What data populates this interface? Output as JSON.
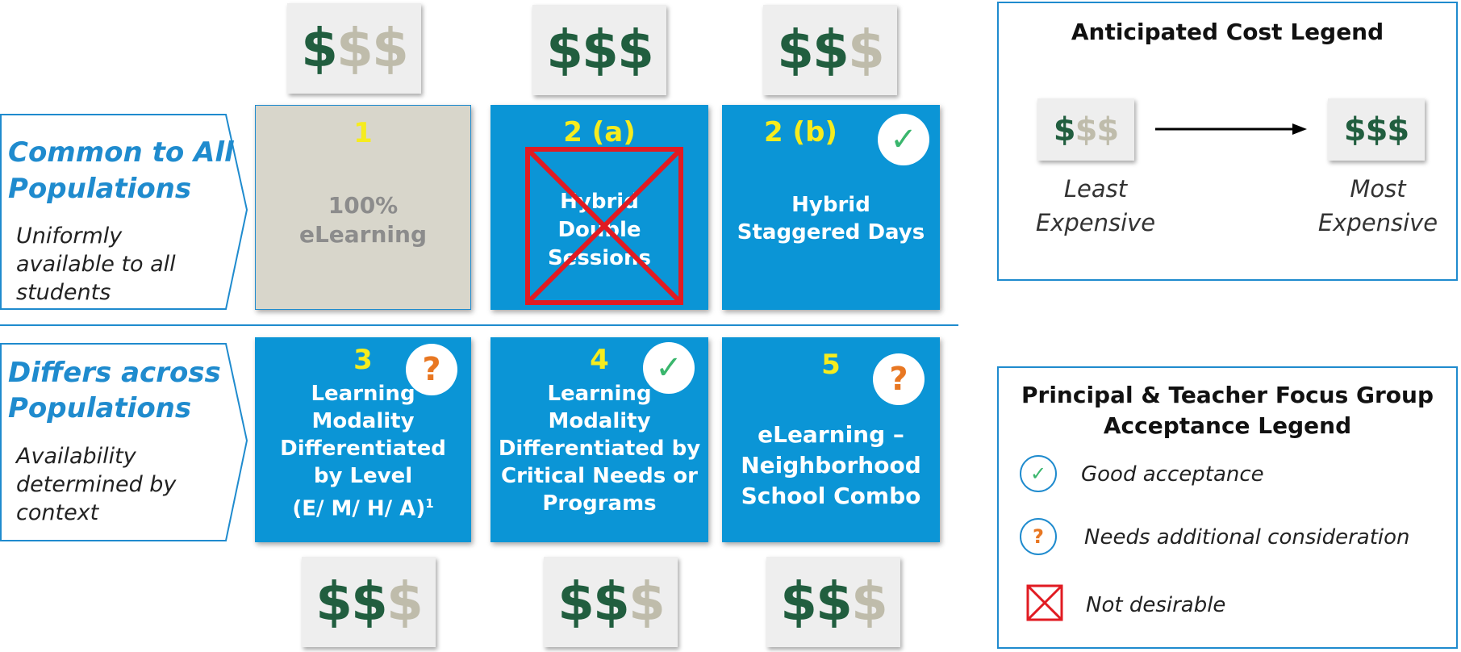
{
  "colors": {
    "blue_tile": "#0b95d6",
    "gray_tile": "#d8d6cb",
    "number_yellow": "#f6ec1e",
    "dollar_active": "#215e3f",
    "dollar_inactive": "#bfbcab",
    "accent_blue": "#1f8bce",
    "check_green": "#3ab66d",
    "question_orange": "#e87722",
    "not_desirable_red": "#e11b22"
  },
  "rows": {
    "common": {
      "title_line1": "Common to All",
      "title_line2": "Populations",
      "sub_line1": "Uniformly",
      "sub_line2": "available to all",
      "sub_line3": "students"
    },
    "differs": {
      "title_line1": "Differs across",
      "title_line2": "Populations",
      "sub_line1": "Availability",
      "sub_line2": "determined by",
      "sub_line3": "context"
    }
  },
  "tiles": [
    {
      "number": "1",
      "lines": [
        "100%",
        "eLearning"
      ],
      "status": "none",
      "cost_level": 1
    },
    {
      "number": "2 (a)",
      "lines": [
        "Hybrid",
        "Double",
        "Sessions"
      ],
      "status": "not-desirable",
      "cost_level": 3
    },
    {
      "number": "2 (b)",
      "lines": [
        "Hybrid",
        "Staggered Days"
      ],
      "status": "good",
      "cost_level": 2
    },
    {
      "number": "3",
      "lines": [
        "Learning",
        "Modality",
        "Differentiated",
        "by Level",
        "(E/ M/ H/ A)"
      ],
      "superscript": "1",
      "status": "needs-consideration",
      "cost_level": 2
    },
    {
      "number": "4",
      "lines": [
        "Learning",
        "Modality",
        "Differentiated by",
        "Critical Needs or",
        "Programs"
      ],
      "status": "good",
      "cost_level": 2
    },
    {
      "number": "5",
      "lines": [
        "eLearning –",
        "Neighborhood",
        "School Combo"
      ],
      "status": "needs-consideration",
      "cost_level": 2
    }
  ],
  "cost_legend": {
    "title": "Anticipated Cost Legend",
    "least_level": 1,
    "most_level": 3,
    "least_line1": "Least",
    "least_line2": "Expensive",
    "most_line1": "Most",
    "most_line2": "Expensive"
  },
  "acceptance_legend": {
    "title_line1": "Principal & Teacher Focus Group",
    "title_line2": "Acceptance Legend",
    "items": [
      {
        "icon": "check-icon",
        "label": "Good acceptance"
      },
      {
        "icon": "question-icon",
        "label": "Needs additional consideration"
      },
      {
        "icon": "red-x-box-icon",
        "label": "Not desirable"
      }
    ]
  },
  "symbols": {
    "dollar": "$",
    "check": "✓",
    "question": "?"
  }
}
